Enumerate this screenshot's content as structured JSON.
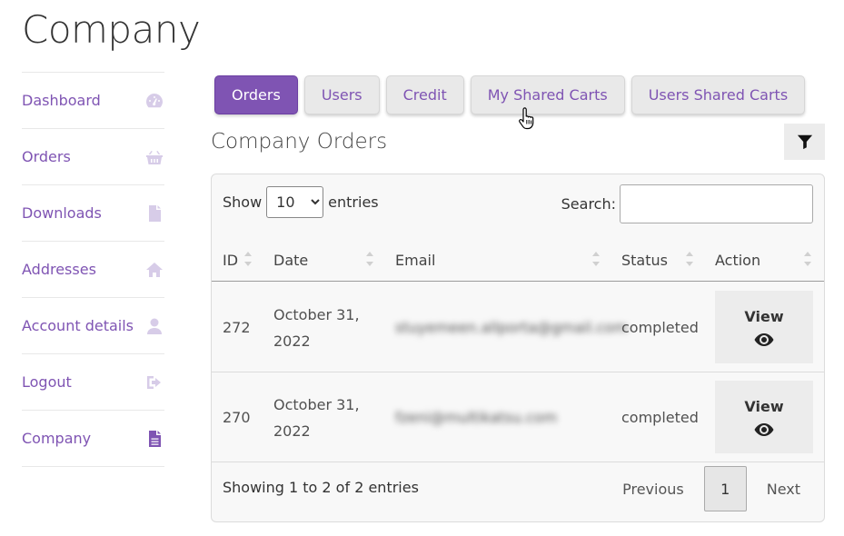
{
  "page": {
    "title": "Company"
  },
  "sidebar": {
    "items": [
      {
        "label": "Dashboard",
        "icon": "gauge-icon"
      },
      {
        "label": "Orders",
        "icon": "basket-icon"
      },
      {
        "label": "Downloads",
        "icon": "file-icon"
      },
      {
        "label": "Addresses",
        "icon": "home-icon"
      },
      {
        "label": "Account details",
        "icon": "user-icon"
      },
      {
        "label": "Logout",
        "icon": "sign-out-icon"
      },
      {
        "label": "Company",
        "icon": "file-text-icon",
        "active": true
      }
    ]
  },
  "tabs": [
    {
      "label": "Orders",
      "active": true
    },
    {
      "label": "Users"
    },
    {
      "label": "Credit"
    },
    {
      "label": "My Shared Carts"
    },
    {
      "label": "Users Shared Carts"
    }
  ],
  "section": {
    "title": "Company Orders"
  },
  "table": {
    "length": {
      "show_label": "Show",
      "entries_label": "entries",
      "selected": "10"
    },
    "search": {
      "label": "Search:",
      "value": ""
    },
    "columns": [
      "ID",
      "Date",
      "Email",
      "Status",
      "Action"
    ],
    "rows": [
      {
        "id": "272",
        "date": "October 31, 2022",
        "email": "stuyemeen.allporta@gmail.com",
        "status": "completed",
        "action": "View"
      },
      {
        "id": "270",
        "date": "October 31, 2022",
        "email": "fzeni@multikatsu.com",
        "status": "completed",
        "action": "View"
      }
    ],
    "info": "Showing 1 to 2 of 2 entries",
    "pagination": {
      "previous": "Previous",
      "current": "1",
      "next": "Next"
    }
  },
  "colors": {
    "accent": "#7f54b3",
    "icon_muted": "#d7cce8"
  }
}
